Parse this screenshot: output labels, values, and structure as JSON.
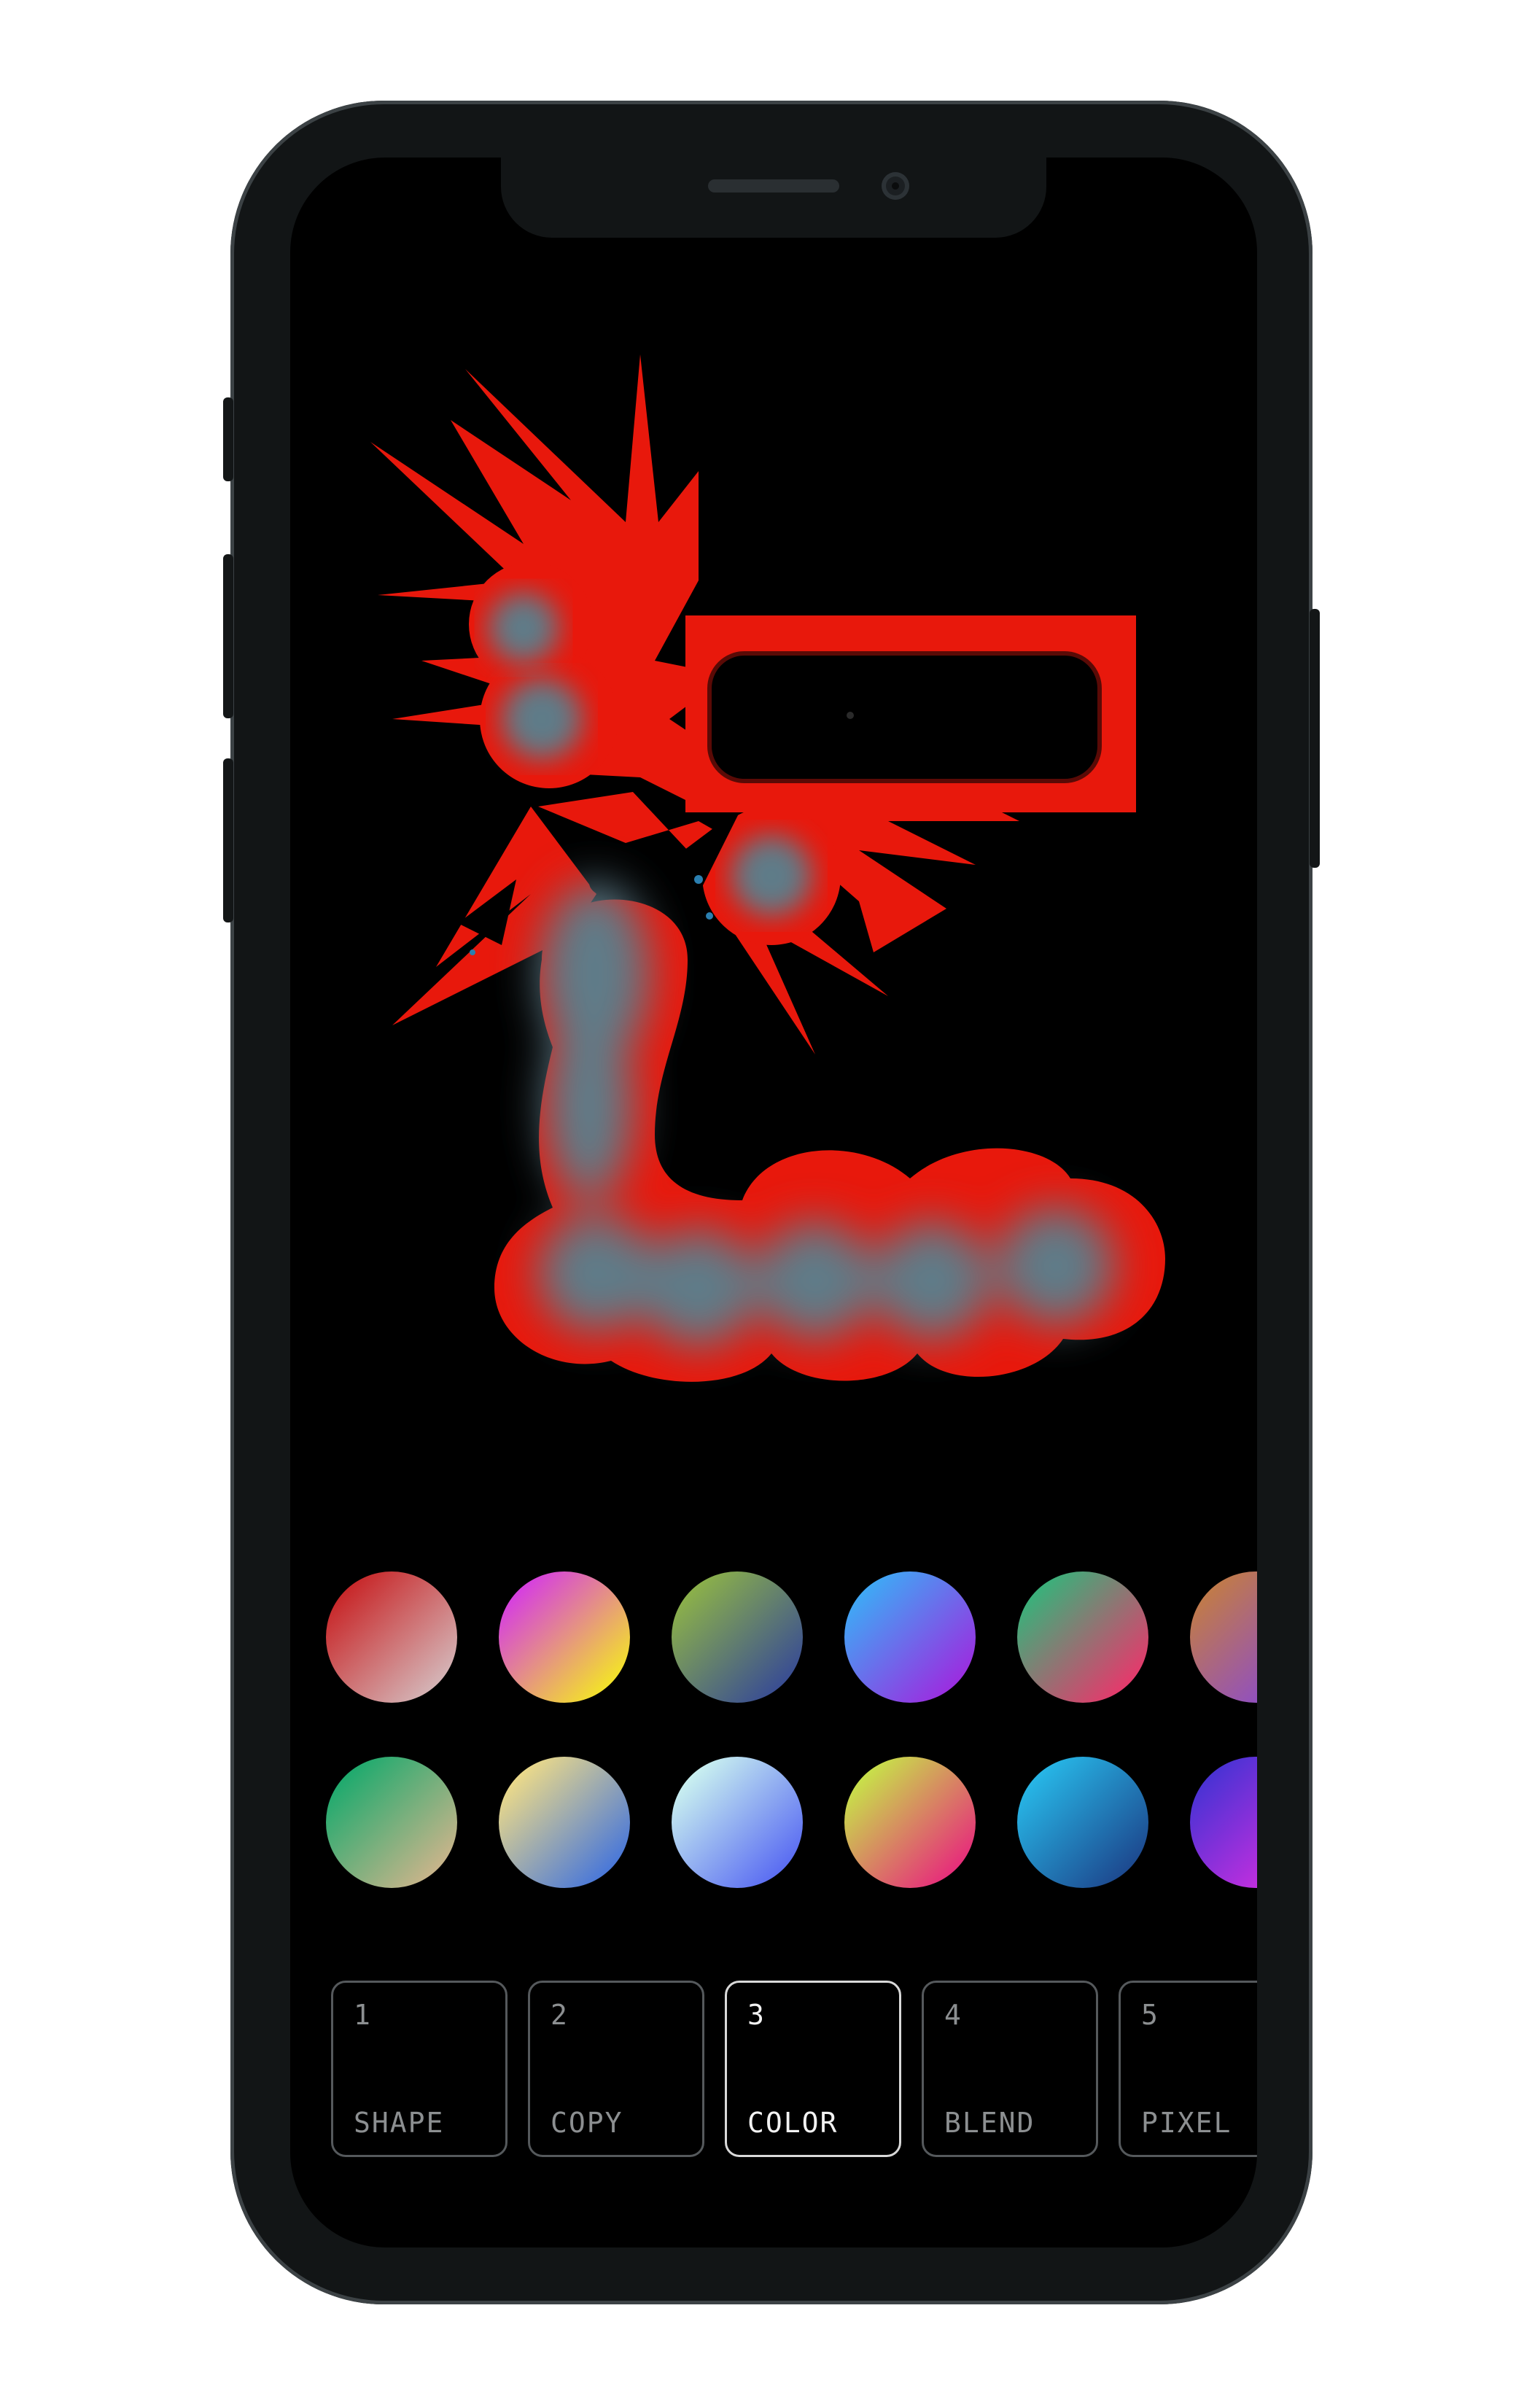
{
  "device": {
    "frame_color": "#121516",
    "screen_color": "#000000"
  },
  "artwork": {
    "primary_color": "#e8180c",
    "fill_color": "#5e7c88",
    "shapes": [
      "spiky-blob-cluster",
      "rounded-pill-in-red-rectangle",
      "L-shaped-blob-chain"
    ]
  },
  "palette": {
    "swatches": [
      {
        "from": "#c8282a",
        "to": "#d4b3b5"
      },
      {
        "from": "#d63fe0",
        "to": "#f3e22a"
      },
      {
        "from": "#8bb04a",
        "to": "#3a4e92"
      },
      {
        "from": "#3fa8f5",
        "to": "#9a2ee0"
      },
      {
        "from": "#3ab07a",
        "to": "#e43a6c"
      },
      {
        "from": "#c07a4a",
        "to": "#8a4ad0"
      },
      {
        "from": "#1faa6e",
        "to": "#c7b48a"
      },
      {
        "from": "#ead98a",
        "to": "#4a78d8"
      },
      {
        "from": "#c9f0f0",
        "to": "#5b6df2"
      },
      {
        "from": "#c8e04a",
        "to": "#e62e7a"
      },
      {
        "from": "#27b6e6",
        "to": "#1d4a90"
      },
      {
        "from": "#4a32d4",
        "to": "#d22ee0"
      }
    ]
  },
  "tabs": [
    {
      "number": "1",
      "label": "SHAPE"
    },
    {
      "number": "2",
      "label": "COPY"
    },
    {
      "number": "3",
      "label": "COLOR"
    },
    {
      "number": "4",
      "label": "BLEND"
    },
    {
      "number": "5",
      "label": "PIXEL"
    }
  ],
  "active_tab": "3"
}
